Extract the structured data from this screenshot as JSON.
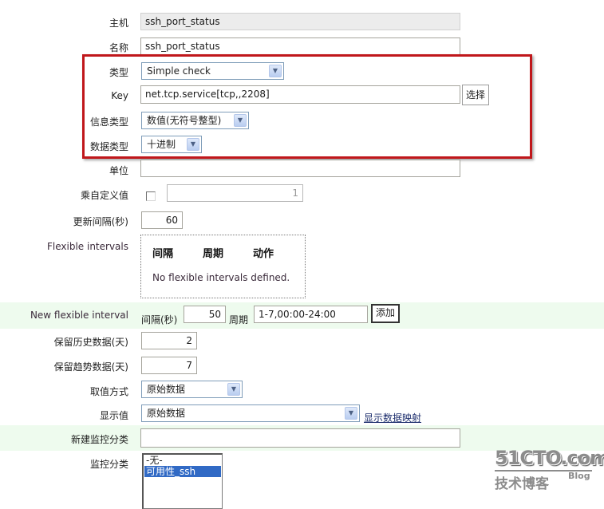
{
  "form": {
    "host": {
      "label": "主机",
      "value": "ssh_port_status"
    },
    "name": {
      "label": "名称",
      "value": "ssh_port_status"
    },
    "type": {
      "label": "类型",
      "value": "Simple check"
    },
    "key": {
      "label": "Key",
      "value": "net.tcp.service[tcp,,2208]",
      "select_button": "选择"
    },
    "info_type": {
      "label": "信息类型",
      "value": "数值(无符号整型)"
    },
    "data_type": {
      "label": "数据类型",
      "value": "十进制"
    },
    "units": {
      "label": "单位",
      "value": ""
    },
    "multiplier": {
      "label": "乘自定义值",
      "checked": false,
      "value": "1"
    },
    "update_interval": {
      "label": "更新间隔(秒)",
      "value": "60"
    },
    "flexible_intervals": {
      "label": "Flexible intervals",
      "columns": [
        "间隔",
        "周期",
        "动作"
      ],
      "empty_text": "No flexible intervals defined."
    },
    "new_flexible_interval": {
      "label": "New flexible interval",
      "interval_label": "间隔(秒)",
      "interval_value": "50",
      "period_label": "周期",
      "period_value": "1-7,00:00-24:00",
      "add_button": "添加"
    },
    "history": {
      "label": "保留历史数据(天)",
      "value": "2"
    },
    "trends": {
      "label": "保留趋势数据(天)",
      "value": "7"
    },
    "store_value": {
      "label": "取值方式",
      "value": "原始数据"
    },
    "show_value": {
      "label": "显示值",
      "value": "原始数据",
      "link": "显示数据映射"
    },
    "new_application": {
      "label": "新建监控分类",
      "value": ""
    },
    "applications": {
      "label": "监控分类",
      "options": [
        {
          "label": "-无-",
          "selected": false
        },
        {
          "label": "可用性_ssh",
          "selected": true
        }
      ]
    }
  },
  "watermark": {
    "main": "51CTO.com",
    "sub": "技术博客",
    "blog": "Blog"
  },
  "colors": {
    "highlight_border": "#c0171b",
    "row_highlight": "#eefbee",
    "selected_option": "#316ac5"
  }
}
